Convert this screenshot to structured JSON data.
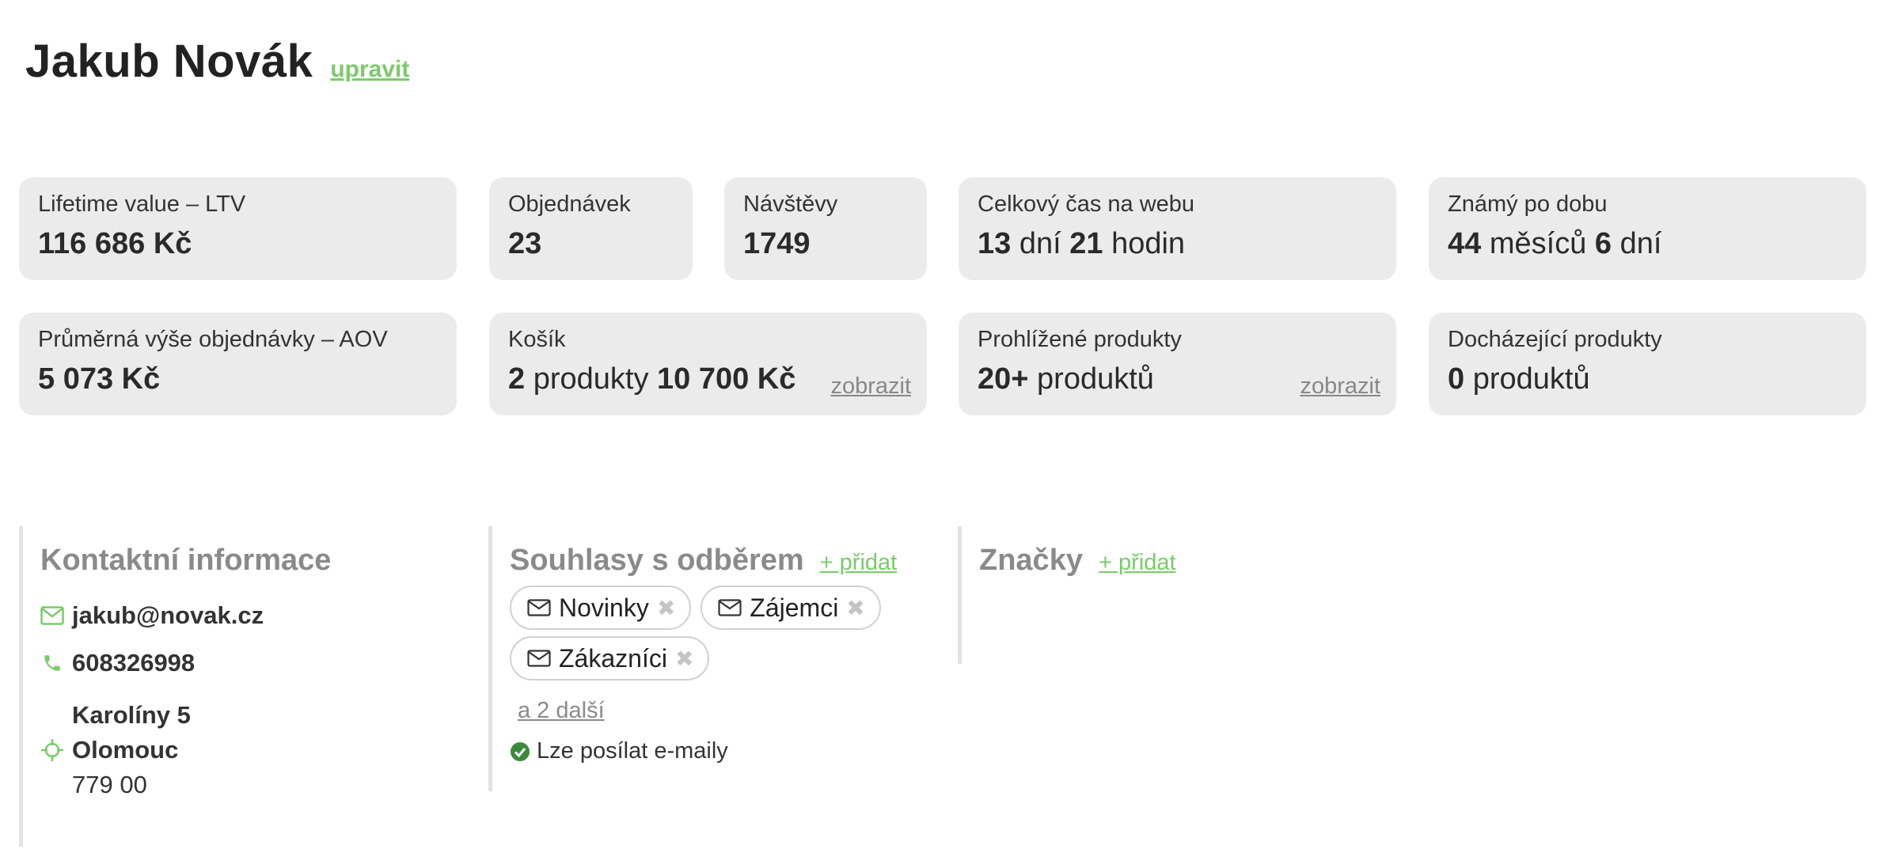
{
  "customer": {
    "name": "Jakub Novák",
    "edit_label": "upravit"
  },
  "stats_row1": {
    "ltv": {
      "label": "Lifetime value – LTV",
      "value": "116 686 Kč"
    },
    "orders": {
      "label": "Objednávek",
      "value": "23"
    },
    "visits": {
      "label": "Návštěvy",
      "value": "1749"
    },
    "time_on_web": {
      "label": "Celkový čas na webu",
      "days": "13",
      "days_unit": "dní",
      "hours": "21",
      "hours_unit": "hodin"
    },
    "known_for": {
      "label": "Známý po dobu",
      "months": "44",
      "months_unit": "měsíců",
      "days": "6",
      "days_unit": "dní"
    }
  },
  "stats_row2": {
    "aov": {
      "label": "Průměrná výše objednávky – AOV",
      "value": "5 073 Kč"
    },
    "cart": {
      "label": "Košík",
      "count": "2",
      "count_unit": "produkty",
      "total": "10 700 Kč",
      "link": "zobrazit"
    },
    "viewed": {
      "label": "Prohlížené produkty",
      "count": "20+",
      "count_unit": "produktů",
      "link": "zobrazit"
    },
    "running_out": {
      "label": "Docházející produkty",
      "count": "0",
      "count_unit": "produktů"
    }
  },
  "contact": {
    "title": "Kontaktní informace",
    "email": "jakub@novak.cz",
    "phone": "608326998",
    "address": {
      "street": "Karolíny 5",
      "city": "Olomouc",
      "zip": "779 00"
    }
  },
  "subscriptions": {
    "title": "Souhlasy s odběrem",
    "add_label": "+ přidat",
    "chips": [
      "Novinky",
      "Zájemci",
      "Zákazníci"
    ],
    "more_label": "a 2 další",
    "status": "Lze posílat e-maily"
  },
  "tags": {
    "title": "Značky",
    "add_label": "+ přidat"
  },
  "colors": {
    "accent": "#7acb6a",
    "ok": "#3a8a3a",
    "card_bg": "#ebebeb"
  },
  "icons": [
    "envelope-icon",
    "phone-icon",
    "location-icon",
    "remove-icon",
    "check-circle-icon"
  ]
}
